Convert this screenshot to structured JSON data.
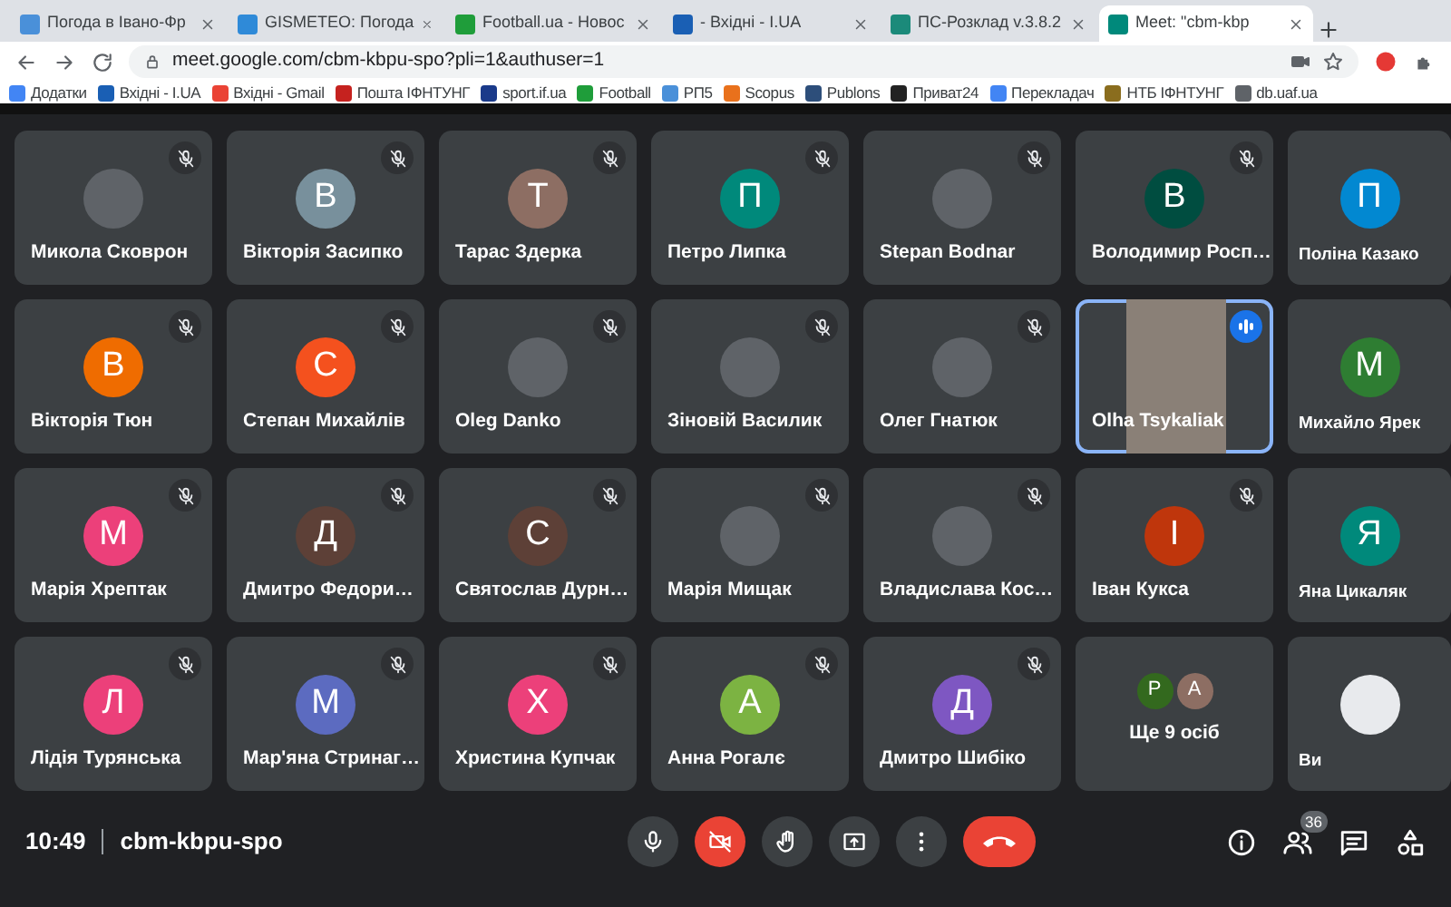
{
  "browser": {
    "tabs": [
      {
        "title": "Погода в Івано-Фр",
        "color": "#4a90d9",
        "selected": false
      },
      {
        "title": "GISMETEO: Погода",
        "color": "#2f8ad8",
        "selected": false
      },
      {
        "title": "Football.ua - Новос",
        "color": "#1f9d3a",
        "selected": false
      },
      {
        "title": "- Вхідні - I.UA",
        "color": "#1a5fb4",
        "selected": false
      },
      {
        "title": "ПС-Розклад v.3.8.2",
        "color": "#1b8a7a",
        "selected": false
      },
      {
        "title": "Meet: \"cbm-kbp",
        "color": "#00897b",
        "selected": true
      }
    ],
    "address": "meet.google.com/cbm-kbpu-spo?pli=1&authuser=1",
    "bookmarks": [
      {
        "label": "Додатки",
        "color": "#4285f4"
      },
      {
        "label": "Вхідні - I.UA",
        "color": "#1a5fb4"
      },
      {
        "label": "Вхідні -  Gmail",
        "color": "#ea4335"
      },
      {
        "label": "Пошта ІФНТУНГ",
        "color": "#c5221f"
      },
      {
        "label": "sport.if.ua",
        "color": "#1a3a8a"
      },
      {
        "label": "Football",
        "color": "#1f9d3a"
      },
      {
        "label": "РП5",
        "color": "#4a90d9"
      },
      {
        "label": "Scopus",
        "color": "#e9711c"
      },
      {
        "label": "Publons",
        "color": "#2d4e7a"
      },
      {
        "label": "Приват24",
        "color": "#222222"
      },
      {
        "label": "Перекладач",
        "color": "#4285f4"
      },
      {
        "label": "НТБ ІФНТУНГ",
        "color": "#8a6d1e"
      },
      {
        "label": "db.uaf.ua",
        "color": "#5f6368"
      }
    ]
  },
  "participants": [
    {
      "name": "Микола Сковрон",
      "kind": "photo",
      "muted": true,
      "speaking": false
    },
    {
      "name": "Вікторія Засипко",
      "kind": "letter",
      "initial": "В",
      "color": "#78909c",
      "muted": true,
      "speaking": false
    },
    {
      "name": "Тарас Здерка",
      "kind": "letter",
      "initial": "Т",
      "color": "#8d6e63",
      "muted": true,
      "speaking": false
    },
    {
      "name": "Петро Липка",
      "kind": "letter",
      "initial": "П",
      "color": "#00897b",
      "muted": true,
      "speaking": false
    },
    {
      "name": "Stepan Bodnar",
      "kind": "photo",
      "muted": true,
      "speaking": false
    },
    {
      "name": "Володимир Росп…",
      "kind": "letter",
      "initial": "В",
      "color": "#004d40",
      "muted": true,
      "speaking": false
    },
    {
      "name": "Поліна Казако",
      "kind": "letter",
      "initial": "П",
      "color": "#0288d1",
      "muted": false,
      "speaking": false
    },
    {
      "name": "Вікторія Тюн",
      "kind": "letter",
      "initial": "В",
      "color": "#ef6c00",
      "muted": true,
      "speaking": false
    },
    {
      "name": "Степан Михайлів",
      "kind": "letter",
      "initial": "С",
      "color": "#f4511e",
      "muted": true,
      "speaking": false
    },
    {
      "name": "Oleg Danko",
      "kind": "photo",
      "muted": true,
      "speaking": false
    },
    {
      "name": "Зіновій Василик",
      "kind": "photo",
      "muted": true,
      "speaking": false
    },
    {
      "name": "Олег Гнатюк",
      "kind": "photo",
      "muted": true,
      "speaking": false
    },
    {
      "name": "Olha Tsykaliak",
      "kind": "video",
      "muted": false,
      "speaking": true
    },
    {
      "name": "Михайло Ярек",
      "kind": "letter",
      "initial": "М",
      "color": "#2e7d32",
      "muted": false,
      "speaking": false
    },
    {
      "name": "Марія Хрептак",
      "kind": "letter",
      "initial": "М",
      "color": "#ec407a",
      "muted": true,
      "speaking": false
    },
    {
      "name": "Дмитро Федори…",
      "kind": "letter",
      "initial": "Д",
      "color": "#5d4037",
      "muted": true,
      "speaking": false
    },
    {
      "name": "Святослав Дурн…",
      "kind": "letter",
      "initial": "С",
      "color": "#5d4037",
      "muted": true,
      "speaking": false
    },
    {
      "name": "Марія Мищак",
      "kind": "photo",
      "muted": true,
      "speaking": false
    },
    {
      "name": "Владислава Кос…",
      "kind": "photo",
      "muted": true,
      "speaking": false
    },
    {
      "name": "Іван Кукса",
      "kind": "letter",
      "initial": "І",
      "color": "#bf360c",
      "muted": true,
      "speaking": false
    },
    {
      "name": "Яна Цикаляк",
      "kind": "letter",
      "initial": "Я",
      "color": "#00897b",
      "muted": false,
      "speaking": false
    },
    {
      "name": "Лідія Турянська",
      "kind": "letter",
      "initial": "Л",
      "color": "#ec407a",
      "muted": true,
      "speaking": false
    },
    {
      "name": "Мар'яна Стринаг…",
      "kind": "letter",
      "initial": "М",
      "color": "#5c6bc0",
      "muted": true,
      "speaking": false
    },
    {
      "name": "Христина Купчак",
      "kind": "letter",
      "initial": "Х",
      "color": "#ec407a",
      "muted": true,
      "speaking": false
    },
    {
      "name": "Анна Рогалє",
      "kind": "letter",
      "initial": "А",
      "color": "#7cb342",
      "muted": true,
      "speaking": false
    },
    {
      "name": "Дмитро Шибіко",
      "kind": "letter",
      "initial": "Д",
      "color": "#7e57c2",
      "muted": true,
      "speaking": false
    },
    {
      "name": "Ще 9 осіб",
      "kind": "group",
      "avatars": [
        {
          "initial": "Р",
          "color": "#33691e"
        },
        {
          "initial": "А",
          "color": "#8d6e63"
        }
      ]
    },
    {
      "name": "Ви",
      "kind": "self",
      "muted": false,
      "speaking": false
    }
  ],
  "meeting": {
    "time": "10:49",
    "code": "cbm-kbpu-spo",
    "mic_muted": false,
    "camera_off": true,
    "people_count": "36"
  }
}
